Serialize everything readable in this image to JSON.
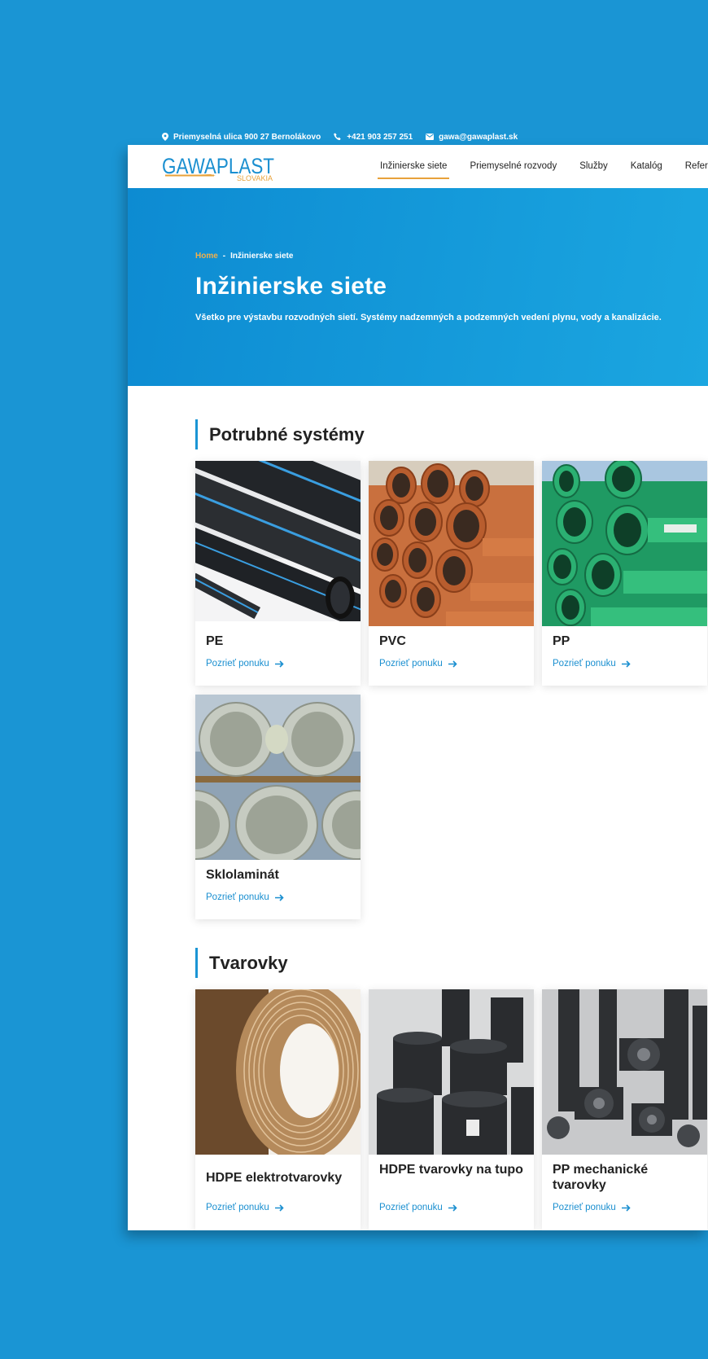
{
  "topbar": {
    "address": "Priemyselná ulica 900 27 Bernolákovo",
    "phone": "+421 903 257 251",
    "email": "gawa@gawaplast.sk"
  },
  "logo": {
    "text_main": "GAWAPLAST",
    "text_sub": "SLOVAKIA"
  },
  "nav": {
    "items": [
      {
        "label": "Inžinierske siete",
        "active": true
      },
      {
        "label": "Priemyselné rozvody"
      },
      {
        "label": "Služby"
      },
      {
        "label": "Katalóg"
      },
      {
        "label": "Referencie"
      }
    ]
  },
  "hero": {
    "breadcrumb_home": "Home",
    "breadcrumb_sep": "-",
    "breadcrumb_current": "Inžinierske siete",
    "title": "Inžinierske siete",
    "description": "Všetko pre výstavbu rozvodných sietí. Systémy nadzemných a podzemných vedení plynu, vody a kanalizácie."
  },
  "sections": [
    {
      "title": "Potrubné systémy",
      "cards": [
        {
          "name": "PE",
          "link": "Pozrieť ponuku"
        },
        {
          "name": "PVC",
          "link": "Pozrieť ponuku"
        },
        {
          "name": "PP",
          "link": "Pozrieť ponuku"
        },
        {
          "name": "Sklolaminát",
          "link": "Pozrieť ponuku"
        }
      ]
    },
    {
      "title": "Tvarovky",
      "cards": [
        {
          "name": "HDPE elektrotvarovky",
          "link": "Pozrieť ponuku"
        },
        {
          "name": "HDPE tvarovky na tupo",
          "link": "Pozrieť ponuku"
        },
        {
          "name": "PP mechanické tvarovky",
          "link": "Pozrieť ponuku"
        }
      ]
    }
  ],
  "colors": {
    "background": "#1a95d4",
    "accent": "#e8a23a",
    "link": "#1a8fd0"
  }
}
